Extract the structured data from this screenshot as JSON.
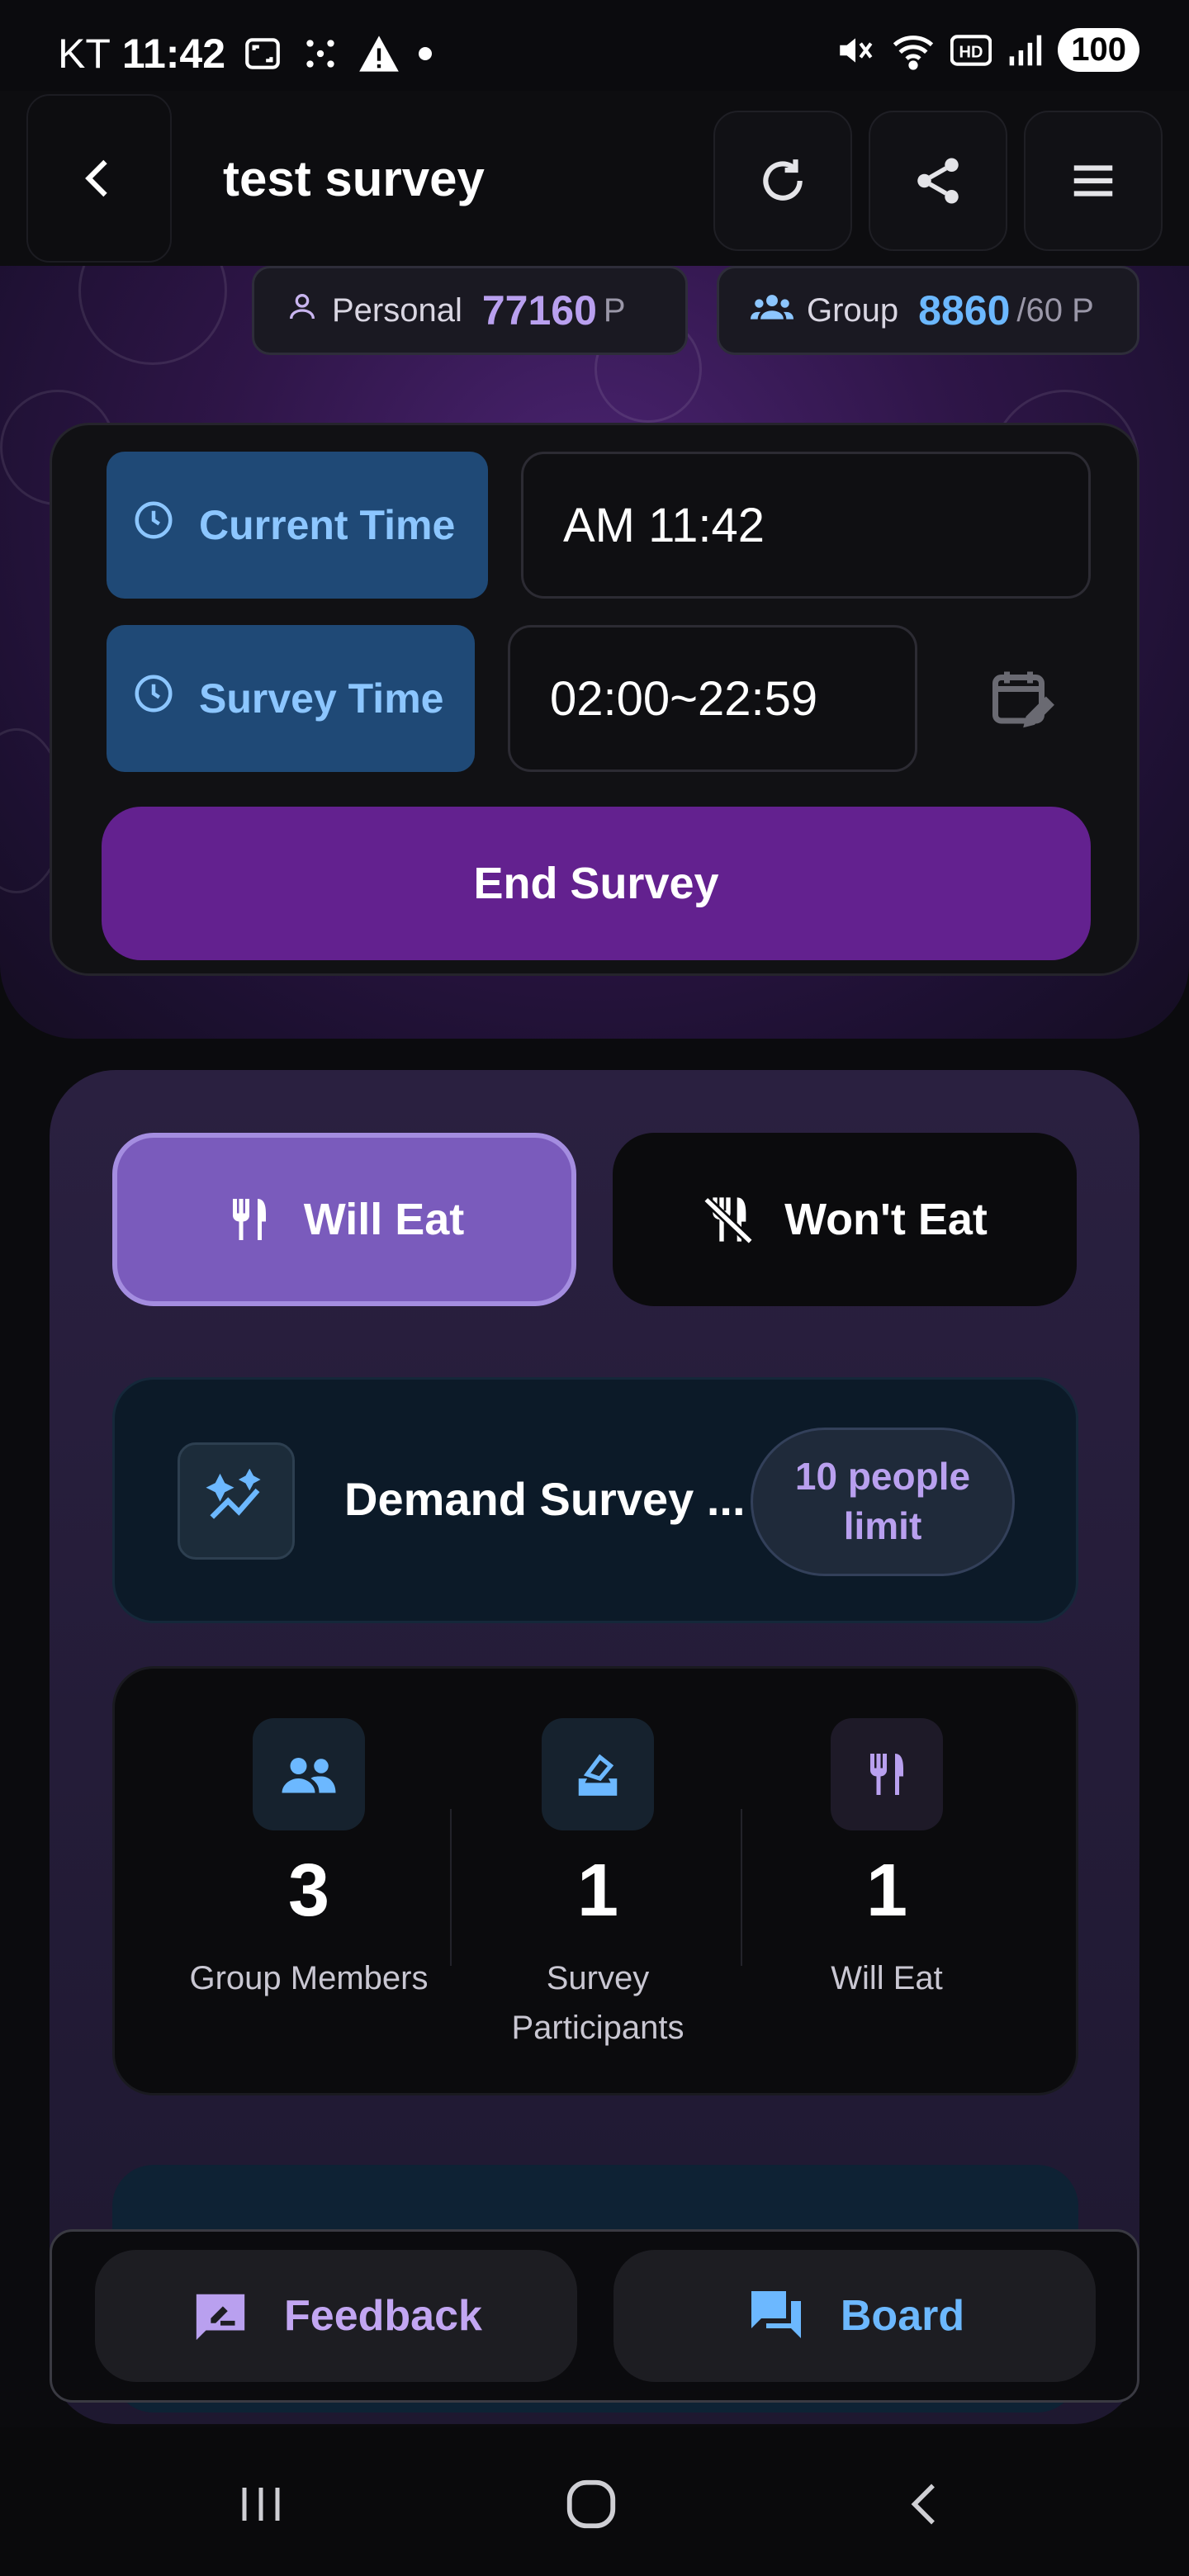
{
  "status_bar": {
    "carrier": "KT",
    "time": "11:42",
    "battery": "100"
  },
  "header": {
    "title": "test survey"
  },
  "points": {
    "personal_label": "Personal",
    "personal_value": "77160",
    "personal_unit": "P",
    "group_label": "Group",
    "group_value": "8860",
    "group_unit": "/60 P"
  },
  "time_card": {
    "current_label": "Current Time",
    "current_value": "AM 11:42",
    "survey_label": "Survey Time",
    "survey_value": "02:00~22:59",
    "end_button": "End Survey"
  },
  "choices": {
    "will_eat": "Will Eat",
    "wont_eat": "Won't Eat"
  },
  "demand": {
    "title": "Demand Survey ...",
    "limit": "10 people limit"
  },
  "stats": [
    {
      "value": "3",
      "label": "Group Members"
    },
    {
      "value": "1",
      "label": "Survey Participants"
    },
    {
      "value": "1",
      "label": "Will Eat"
    }
  ],
  "bottom_bar": {
    "feedback": "Feedback",
    "board": "Board"
  },
  "colors": {
    "accent_purple": "#7a5bbc",
    "end_button": "#63218f",
    "time_badge": "#1f4976",
    "blue_text": "#8cc6ff",
    "purple_text": "#b9a0ef"
  }
}
